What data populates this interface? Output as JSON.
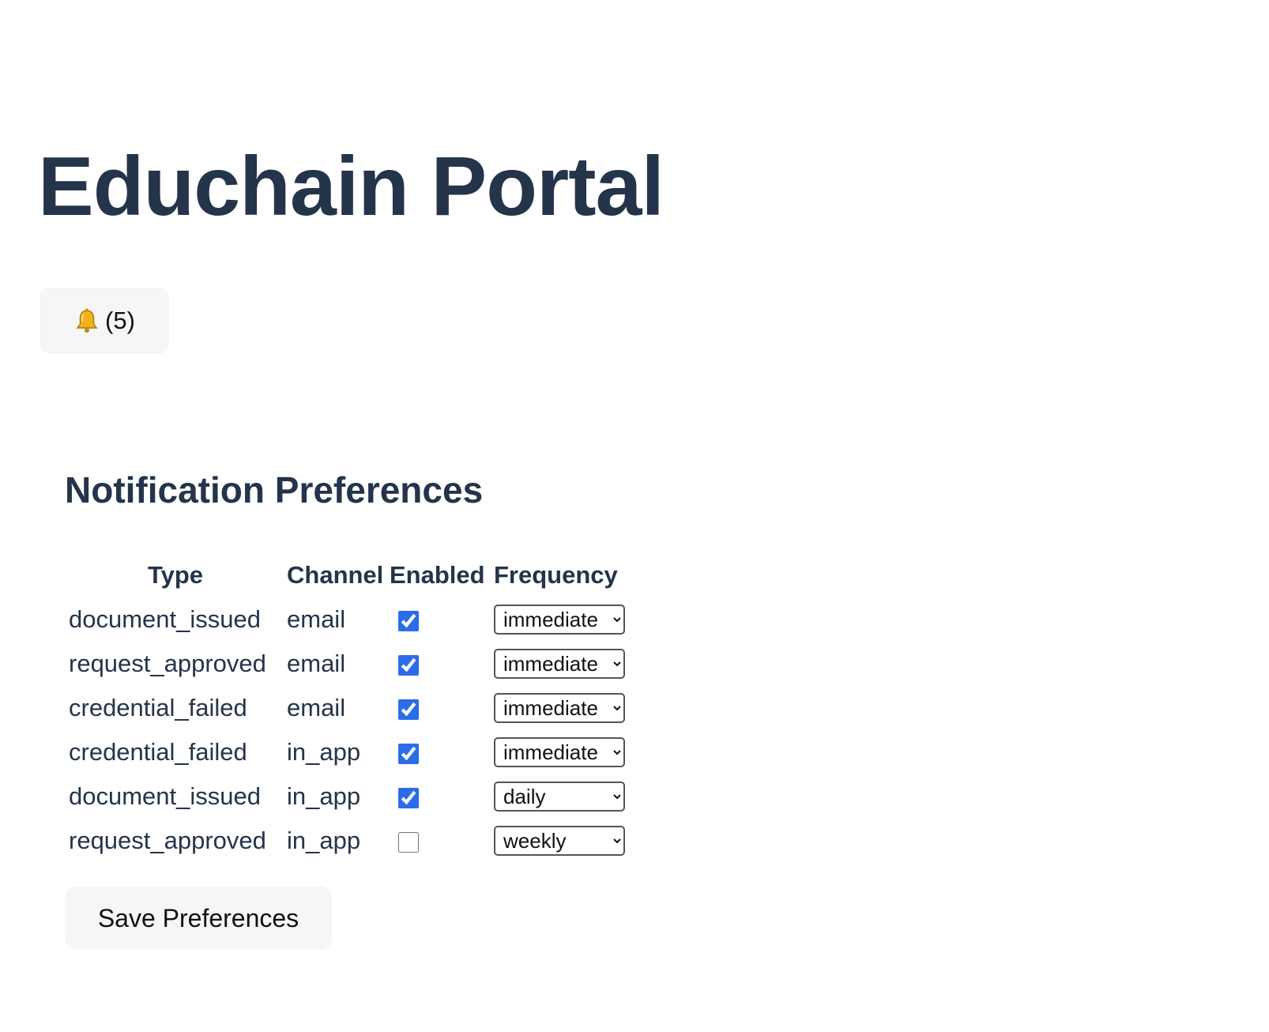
{
  "app": {
    "title": "Educhain Portal"
  },
  "notifications": {
    "icon": "bell-icon",
    "count_label": "(5)"
  },
  "preferences": {
    "heading": "Notification Preferences",
    "columns": [
      "Type",
      "Channel",
      "Enabled",
      "Frequency"
    ],
    "rows": [
      {
        "type": "document_issued",
        "channel": "email",
        "enabled": true,
        "frequency": "immediate"
      },
      {
        "type": "request_approved",
        "channel": "email",
        "enabled": true,
        "frequency": "immediate"
      },
      {
        "type": "credential_failed",
        "channel": "email",
        "enabled": true,
        "frequency": "immediate"
      },
      {
        "type": "credential_failed",
        "channel": "in_app",
        "enabled": true,
        "frequency": "immediate"
      },
      {
        "type": "document_issued",
        "channel": "in_app",
        "enabled": true,
        "frequency": "daily"
      },
      {
        "type": "request_approved",
        "channel": "in_app",
        "enabled": false,
        "frequency": "weekly"
      }
    ],
    "frequency_options": [
      "immediate",
      "daily",
      "weekly"
    ],
    "save_label": "Save Preferences"
  },
  "colors": {
    "heading": "#24344a",
    "checkbox_accent": "#2b6de8",
    "button_bg": "#f6f6f6"
  }
}
